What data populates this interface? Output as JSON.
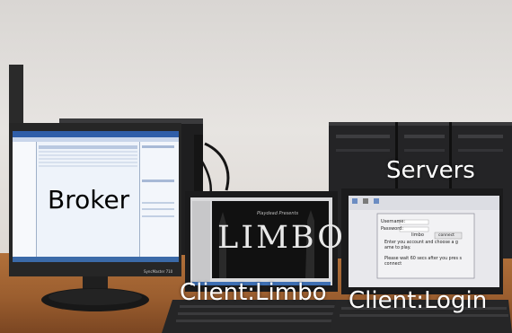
{
  "labels": {
    "broker": "Broker",
    "servers": "Servers",
    "client_limbo": "Client:Limbo",
    "client_login": "Client:Login"
  },
  "limbo_game": {
    "subtitle": "Playdead Presents",
    "logo_text": "LIMBO"
  },
  "login_dialog": {
    "username_label": "Username:",
    "password_label": "Password:",
    "username_value": "limbo",
    "connect_label": "connect",
    "message_1": "Enter you account and choose a g ame to play.",
    "message_2": "Please wait 60 secs after you pres s connect"
  },
  "monitor": {
    "model_label": "SyncMaster 710"
  },
  "colors": {
    "wall": "#e2dfdc",
    "desk": "#9b5e2f",
    "broker_screen": "#eef3fa",
    "limbo_screen": "#111111",
    "login_screen": "#e8e8ec"
  }
}
